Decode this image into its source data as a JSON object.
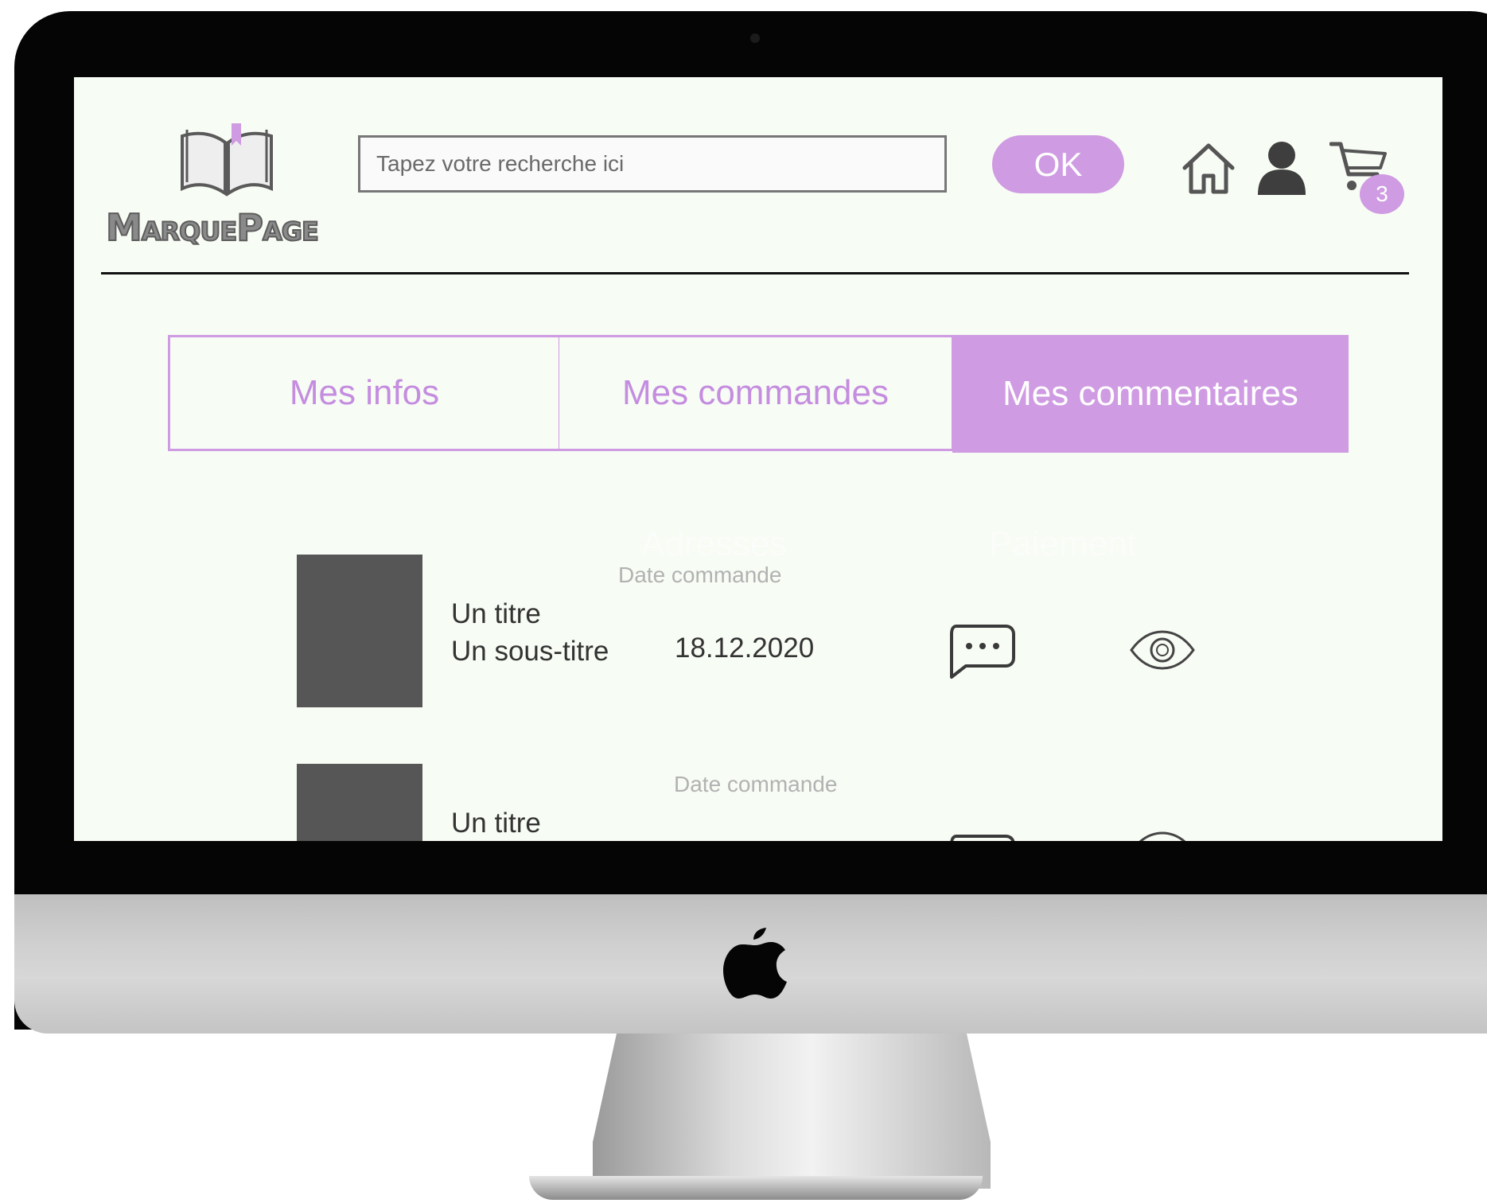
{
  "brand": {
    "name": "MarquePage"
  },
  "search": {
    "placeholder": "Tapez votre recherche ici",
    "button_label": "OK"
  },
  "header": {
    "icons": [
      "home-icon",
      "user-icon",
      "cart-icon"
    ],
    "cart_count": "3"
  },
  "tabs": [
    {
      "label": "Mes infos",
      "active": false
    },
    {
      "label": "Mes commandes",
      "active": false
    },
    {
      "label": "Mes commentaires",
      "active": true
    }
  ],
  "hidden_headers": [
    "Adresses",
    "Paiement"
  ],
  "rows": [
    {
      "title": "Un titre",
      "subtitle": "Un sous-titre",
      "date_header": "Date commande",
      "date": "18.12.2020",
      "action_icons": [
        "comment-icon",
        "eye-icon"
      ]
    },
    {
      "title": "Un titre",
      "date_header": "Date commande",
      "action_icons": [
        "comment-icon",
        "eye-icon"
      ]
    }
  ],
  "colors": {
    "accent": "#cf9be2",
    "screen_background": "#f7fcf4",
    "thumbnail": "#565656",
    "text": "#333333"
  }
}
